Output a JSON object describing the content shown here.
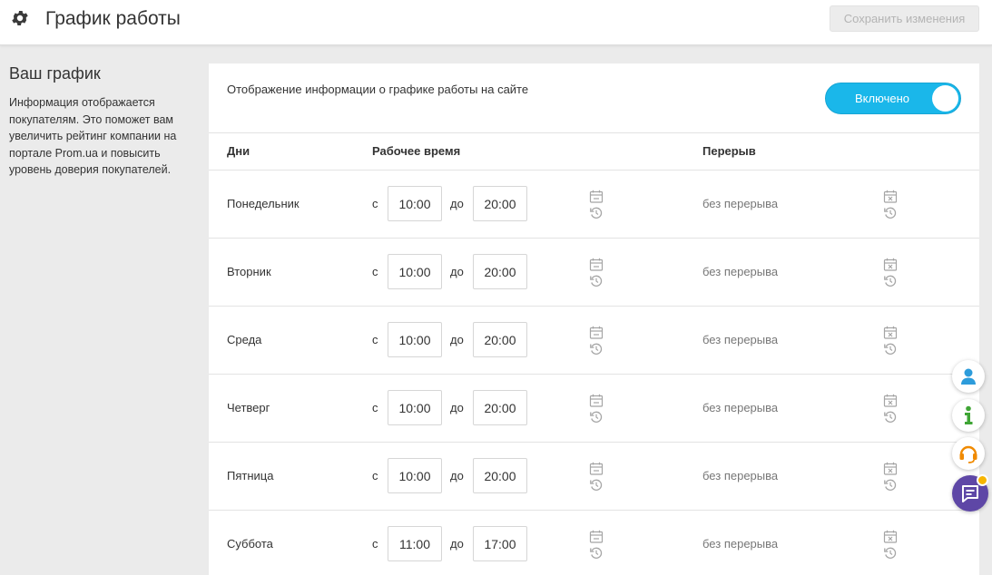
{
  "header": {
    "title": "График работы",
    "save_label": "Сохранить изменения"
  },
  "sidebar": {
    "title": "Ваш график",
    "text": "Информация отображается покупателям. Это поможет вам увеличить рейтинг компании на портале Prom.ua и повысить уровень доверия покупателей."
  },
  "display": {
    "label": "Отображение информации о графике работы на сайте",
    "toggle_label": "Включено",
    "enabled": true
  },
  "table": {
    "headers": {
      "days": "Дни",
      "work_time": "Рабочее время",
      "break": "Перерыв"
    },
    "from_label": "с",
    "to_label": "до",
    "no_break": "без перерыва",
    "rows": [
      {
        "day": "Понедельник",
        "from": "10:00",
        "to": "20:00"
      },
      {
        "day": "Вторник",
        "from": "10:00",
        "to": "20:00"
      },
      {
        "day": "Среда",
        "from": "10:00",
        "to": "20:00"
      },
      {
        "day": "Четверг",
        "from": "10:00",
        "to": "20:00"
      },
      {
        "day": "Пятница",
        "from": "10:00",
        "to": "20:00"
      },
      {
        "day": "Суббота",
        "from": "11:00",
        "to": "17:00"
      }
    ]
  },
  "fabs": {
    "icons": [
      "user-icon",
      "info-icon",
      "headset-icon",
      "chat-icon"
    ],
    "colors": {
      "user": "#2d9cdb",
      "info": "#3fa535",
      "support": "#f08a00",
      "chat": "#5e47a6",
      "badge": "#f7b500"
    }
  },
  "colors": {
    "accent": "#1ab7ea",
    "background": "#ebebeb"
  }
}
